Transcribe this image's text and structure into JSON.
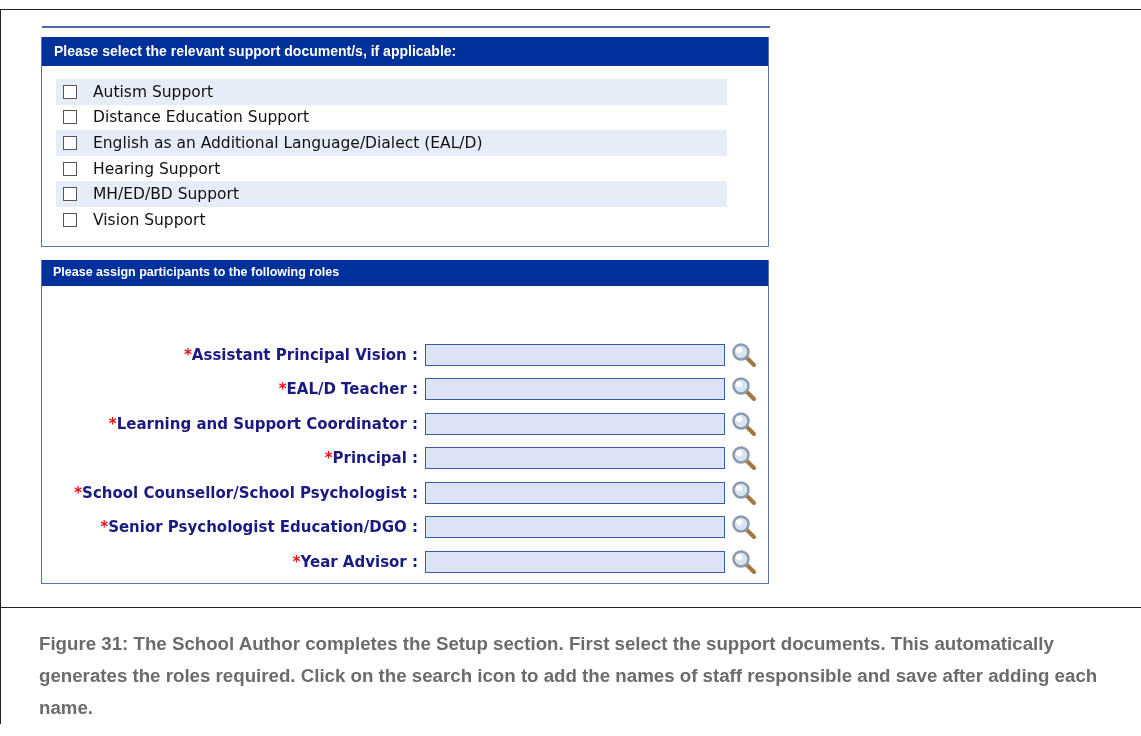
{
  "support_panel": {
    "title": "Please select the relevant support document/s, if applicable:",
    "options": [
      {
        "label": "Autism Support",
        "checked": false
      },
      {
        "label": "Distance Education Support",
        "checked": false
      },
      {
        "label": "English as an Additional Language/Dialect (EAL/D)",
        "checked": false
      },
      {
        "label": "Hearing Support",
        "checked": false
      },
      {
        "label": "MH/ED/BD Support",
        "checked": false
      },
      {
        "label": "Vision Support",
        "checked": false
      }
    ]
  },
  "roles_panel": {
    "title": "Please assign participants to the following roles",
    "roles": [
      {
        "marker": "*",
        "label": "Assistant Principal Vision :"
      },
      {
        "marker": "*",
        "label": "EAL/D Teacher :"
      },
      {
        "marker": "*",
        "label": "Learning and Support Coordinator :"
      },
      {
        "marker": "*",
        "label": "Principal :"
      },
      {
        "marker": "*",
        "label": "School Counsellor/School Psychologist :"
      },
      {
        "marker": "*",
        "label": "Senior Psychologist Education/DGO :"
      },
      {
        "marker": "*",
        "label": "Year Advisor :"
      }
    ]
  },
  "caption": "Figure 31: The School Author completes the Setup section. First select the support documents. This automatically generates the roles required. Click on the search icon to add the names of staff responsible and save after adding each name."
}
